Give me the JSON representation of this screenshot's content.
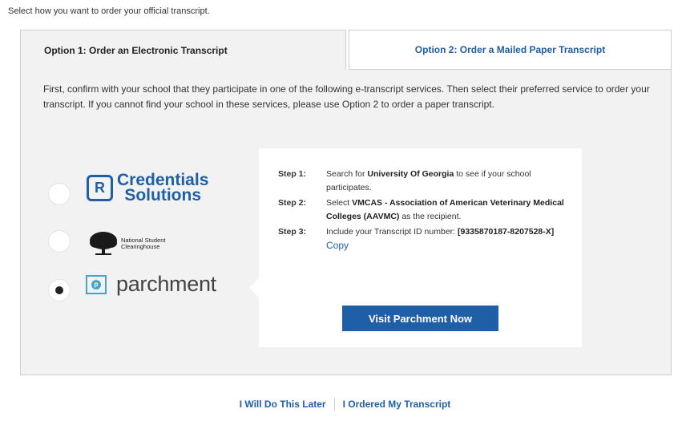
{
  "intro": "Select how you want to order your official transcript.",
  "tabs": {
    "electronic": "Option 1: Order an Electronic Transcript",
    "mailed": "Option 2: Order a Mailed Paper Transcript"
  },
  "instructions": "First, confirm with your school that they participate in one of the following e-transcript services. Then select their preferred service to order your transcript. If you cannot find your school in these services, please use Option 2 to order a paper transcript.",
  "services": {
    "credentials": {
      "line1": "Credentials",
      "line2": "Solutions",
      "mark": "R"
    },
    "nsc": {
      "line1": "National Student",
      "line2": "Clearinghouse"
    },
    "parchment": {
      "name": "parchment",
      "selected": true
    }
  },
  "steps": [
    {
      "label": "Step 1:",
      "pre": "Search for ",
      "bold": "University Of Georgia",
      "post": " to see if your school participates."
    },
    {
      "label": "Step 2:",
      "pre": "Select ",
      "bold": "VMCAS - Association of American Veterinary Medical Colleges (AAVMC)",
      "post": " as the recipient."
    },
    {
      "label": "Step 3:",
      "pre": "Include your Transcript ID number: ",
      "bold": "[9335870187-8207528-X]",
      "post": ""
    }
  ],
  "copy_label": "Copy",
  "visit_button": "Visit Parchment Now",
  "footer": {
    "later": "I Will Do This Later",
    "ordered": "I Ordered My Transcript"
  },
  "colors": {
    "accent": "#1f5fa8",
    "panel": "#f2f2f2"
  }
}
